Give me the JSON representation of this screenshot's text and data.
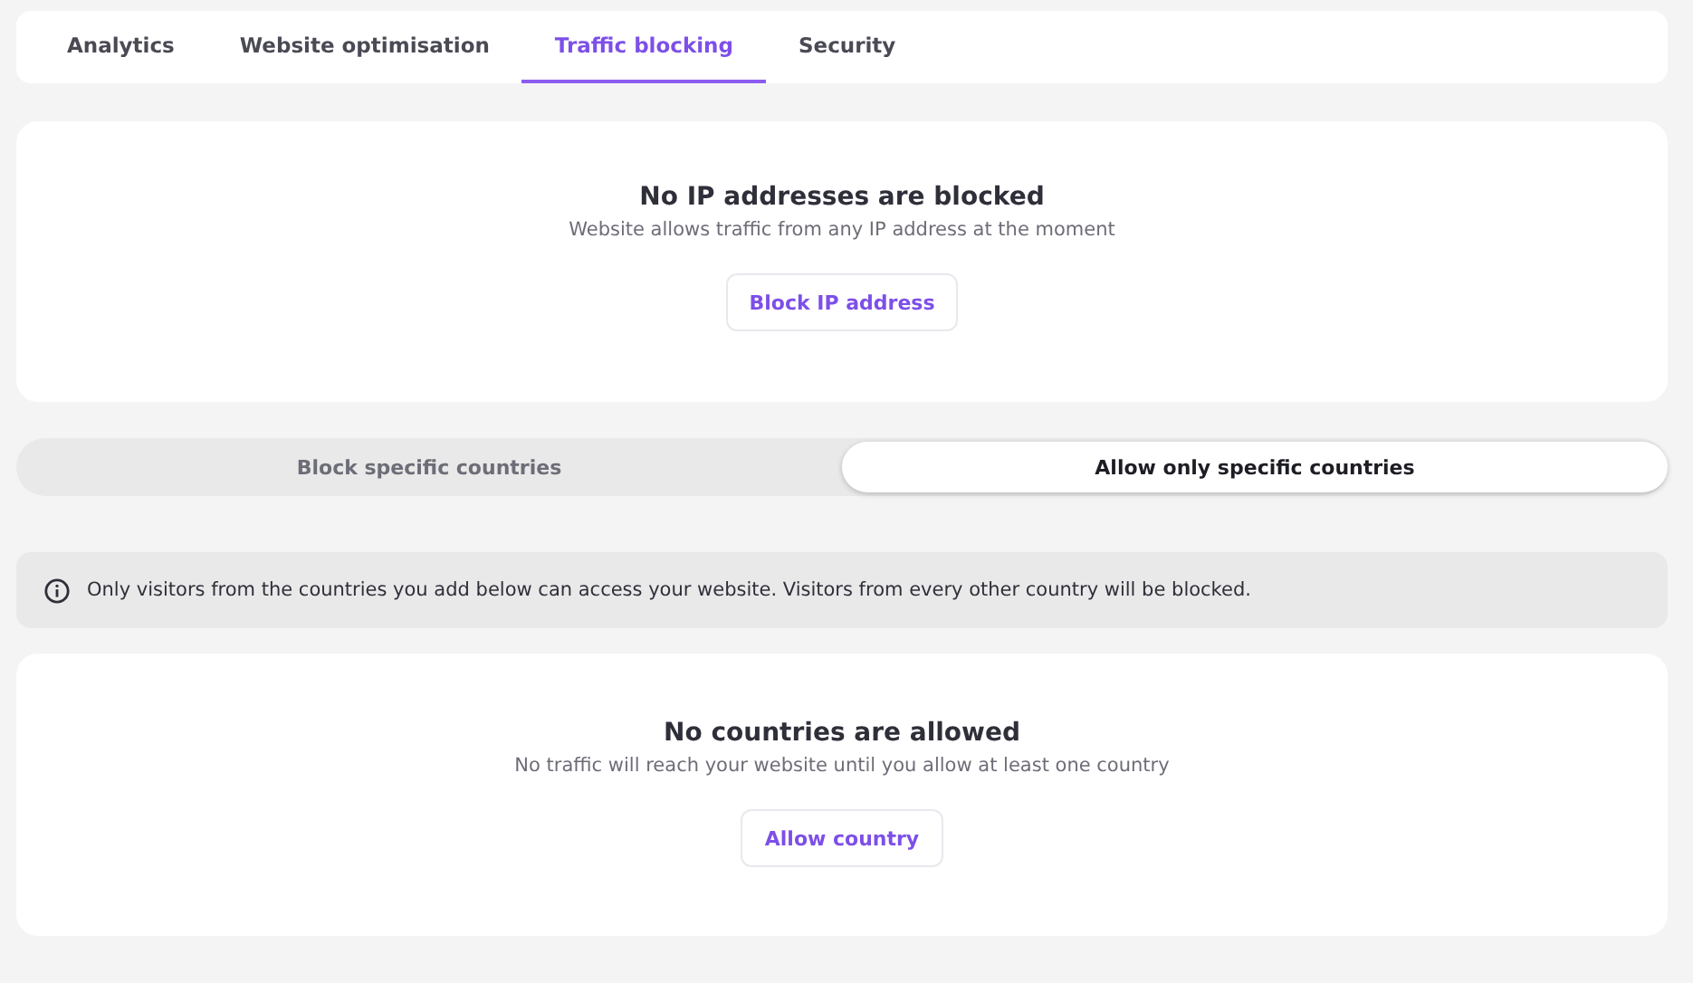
{
  "tabs": [
    {
      "label": "Analytics",
      "selected": false
    },
    {
      "label": "Website optimisation",
      "selected": false
    },
    {
      "label": "Traffic blocking",
      "selected": true
    },
    {
      "label": "Security",
      "selected": false
    }
  ],
  "ip_card": {
    "title": "No IP addresses are blocked",
    "description": "Website allows traffic from any IP address at the moment",
    "button": "Block IP address"
  },
  "mode_switch": [
    {
      "label": "Block specific countries",
      "selected": false
    },
    {
      "label": "Allow only specific countries",
      "selected": true
    }
  ],
  "info_notice": "Only visitors from the countries you add below can access your website. Visitors from every other country will be blocked.",
  "country_card": {
    "title": "No countries are allowed",
    "description": "No traffic will reach your website until you allow at least one country",
    "button": "Allow country"
  }
}
